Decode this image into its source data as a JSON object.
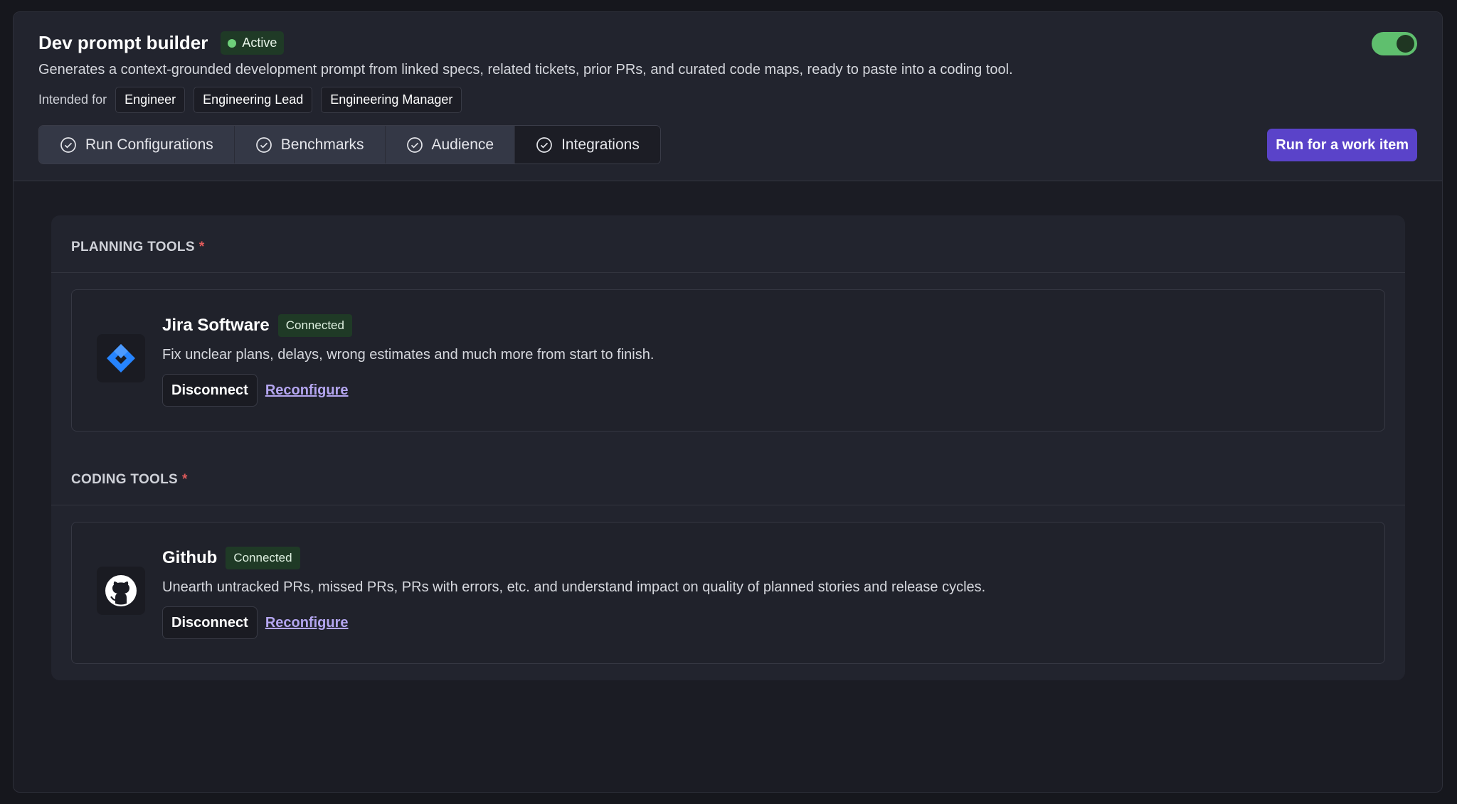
{
  "header": {
    "title": "Dev prompt builder",
    "status": "Active",
    "description": "Generates a context-grounded development prompt from linked specs, related tickets, prior PRs, and curated code maps, ready to paste into a coding tool.",
    "intended_for_label": "Intended for",
    "audiences": [
      "Engineer",
      "Engineering Lead",
      "Engineering Manager"
    ],
    "enabled": true
  },
  "tabs": [
    {
      "label": "Run Configurations",
      "icon": "check-circle-icon"
    },
    {
      "label": "Benchmarks",
      "icon": "check-circle-icon"
    },
    {
      "label": "Audience",
      "icon": "check-circle-icon"
    },
    {
      "label": "Integrations",
      "icon": "check-circle-icon",
      "active": true
    }
  ],
  "run_button": "Run for a work item",
  "sections": [
    {
      "title": "PLANNING TOOLS",
      "required_mark": "*",
      "tool": {
        "name": "Jira Software",
        "icon": "jira-icon",
        "status": "Connected",
        "description": "Fix unclear plans, delays, wrong estimates and much more from start to finish.",
        "disconnect_label": "Disconnect",
        "reconfigure_label": "Reconfigure"
      }
    },
    {
      "title": "CODING TOOLS",
      "required_mark": "*",
      "tool": {
        "name": "Github",
        "icon": "github-icon",
        "status": "Connected",
        "description": "Unearth untracked PRs, missed PRs, PRs with errors, etc. and understand impact on quality of planned stories and release cycles.",
        "disconnect_label": "Disconnect",
        "reconfigure_label": "Reconfigure"
      }
    }
  ],
  "colors": {
    "accent": "#5a43c9",
    "status_green": "#6ed07a",
    "toggle_on": "#5fbf6e",
    "link": "#b4a6f0",
    "required": "#e05a5a",
    "jira_blue": "#2684ff"
  }
}
